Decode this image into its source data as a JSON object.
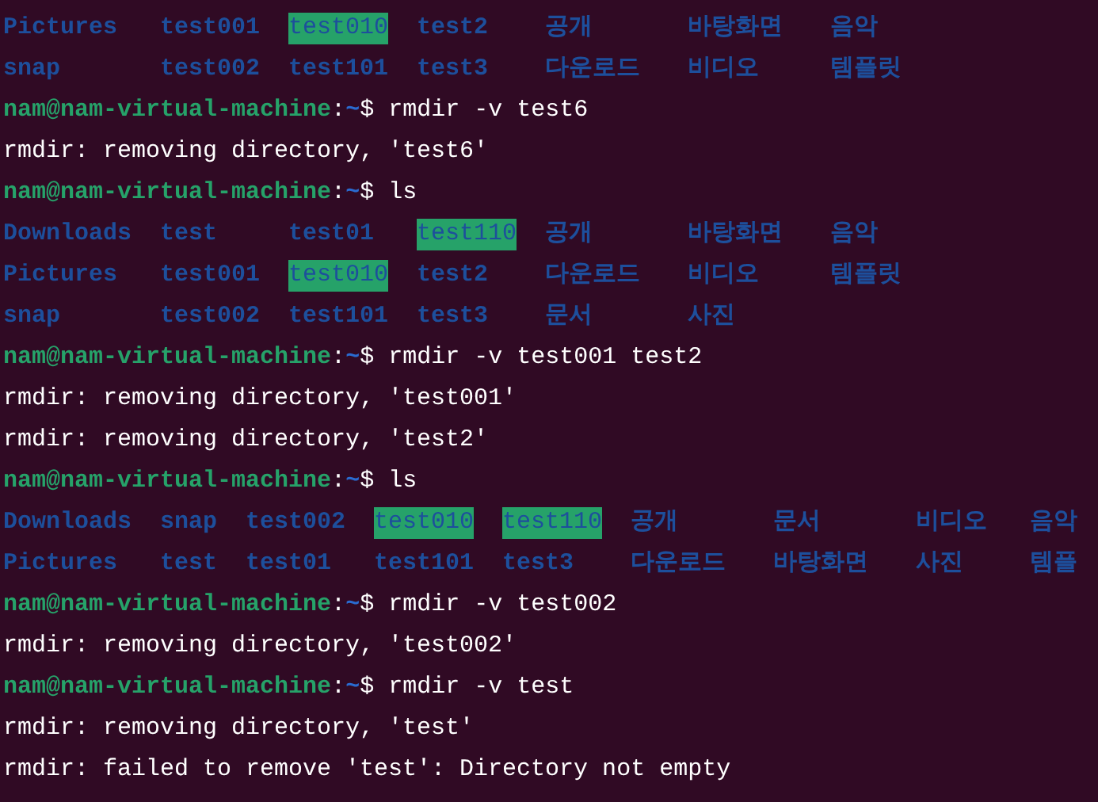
{
  "lines": [
    {
      "kind": "listing",
      "rows": [
        [
          {
            "text": "Pictures",
            "highlighted": false
          },
          {
            "text": "test001",
            "highlighted": false
          },
          {
            "text": "test010",
            "highlighted": true
          },
          {
            "text": "test2",
            "highlighted": false
          },
          {
            "text": "공개",
            "highlighted": false
          },
          {
            "text": "바탕화면",
            "highlighted": false
          },
          {
            "text": "음악",
            "highlighted": false
          }
        ],
        [
          {
            "text": "snap",
            "highlighted": false
          },
          {
            "text": "test002",
            "highlighted": false
          },
          {
            "text": "test101",
            "highlighted": false
          },
          {
            "text": "test3",
            "highlighted": false
          },
          {
            "text": "다운로드",
            "highlighted": false
          },
          {
            "text": "비디오",
            "highlighted": false
          },
          {
            "text": "템플릿",
            "highlighted": false
          }
        ]
      ]
    },
    {
      "kind": "prompt",
      "user": "nam@nam-virtual-machine",
      "separator": ":",
      "path": "~",
      "symbol": "$",
      "command": "rmdir -v test6"
    },
    {
      "kind": "output",
      "text": "rmdir: removing directory, 'test6'"
    },
    {
      "kind": "prompt",
      "user": "nam@nam-virtual-machine",
      "separator": ":",
      "path": "~",
      "symbol": "$",
      "command": "ls"
    },
    {
      "kind": "listing",
      "rows": [
        [
          {
            "text": "Downloads",
            "highlighted": false
          },
          {
            "text": "test",
            "highlighted": false
          },
          {
            "text": "test01",
            "highlighted": false
          },
          {
            "text": "test110",
            "highlighted": true
          },
          {
            "text": "공개",
            "highlighted": false
          },
          {
            "text": "바탕화면",
            "highlighted": false
          },
          {
            "text": "음악",
            "highlighted": false
          }
        ],
        [
          {
            "text": "Pictures",
            "highlighted": false
          },
          {
            "text": "test001",
            "highlighted": false
          },
          {
            "text": "test010",
            "highlighted": true
          },
          {
            "text": "test2",
            "highlighted": false
          },
          {
            "text": "다운로드",
            "highlighted": false
          },
          {
            "text": "비디오",
            "highlighted": false
          },
          {
            "text": "템플릿",
            "highlighted": false
          }
        ],
        [
          {
            "text": "snap",
            "highlighted": false
          },
          {
            "text": "test002",
            "highlighted": false
          },
          {
            "text": "test101",
            "highlighted": false
          },
          {
            "text": "test3",
            "highlighted": false
          },
          {
            "text": "문서",
            "highlighted": false
          },
          {
            "text": "사진",
            "highlighted": false
          }
        ]
      ]
    },
    {
      "kind": "prompt",
      "user": "nam@nam-virtual-machine",
      "separator": ":",
      "path": "~",
      "symbol": "$",
      "command": "rmdir -v test001 test2"
    },
    {
      "kind": "output",
      "text": "rmdir: removing directory, 'test001'"
    },
    {
      "kind": "output",
      "text": "rmdir: removing directory, 'test2'"
    },
    {
      "kind": "prompt",
      "user": "nam@nam-virtual-machine",
      "separator": ":",
      "path": "~",
      "symbol": "$",
      "command": "ls"
    },
    {
      "kind": "listing",
      "rows": [
        [
          {
            "text": "Downloads",
            "highlighted": false
          },
          {
            "text": "snap",
            "highlighted": false
          },
          {
            "text": "test002",
            "highlighted": false
          },
          {
            "text": "test010",
            "highlighted": true
          },
          {
            "text": "test110",
            "highlighted": true
          },
          {
            "text": "공개",
            "highlighted": false
          },
          {
            "text": "문서",
            "highlighted": false
          },
          {
            "text": "비디오",
            "highlighted": false
          },
          {
            "text": "음악",
            "highlighted": false
          }
        ],
        [
          {
            "text": "Pictures",
            "highlighted": false
          },
          {
            "text": "test",
            "highlighted": false
          },
          {
            "text": "test01",
            "highlighted": false
          },
          {
            "text": "test101",
            "highlighted": false
          },
          {
            "text": "test3",
            "highlighted": false
          },
          {
            "text": "다운로드",
            "highlighted": false
          },
          {
            "text": "바탕화면",
            "highlighted": false
          },
          {
            "text": "사진",
            "highlighted": false
          },
          {
            "text": "템플",
            "highlighted": false
          }
        ]
      ]
    },
    {
      "kind": "prompt",
      "user": "nam@nam-virtual-machine",
      "separator": ":",
      "path": "~",
      "symbol": "$",
      "command": "rmdir -v test002"
    },
    {
      "kind": "output",
      "text": "rmdir: removing directory, 'test002'"
    },
    {
      "kind": "prompt",
      "user": "nam@nam-virtual-machine",
      "separator": ":",
      "path": "~",
      "symbol": "$",
      "command": "rmdir -v test"
    },
    {
      "kind": "output",
      "text": "rmdir: removing directory, 'test'"
    },
    {
      "kind": "output",
      "text": "rmdir: failed to remove 'test': Directory not empty"
    }
  ]
}
